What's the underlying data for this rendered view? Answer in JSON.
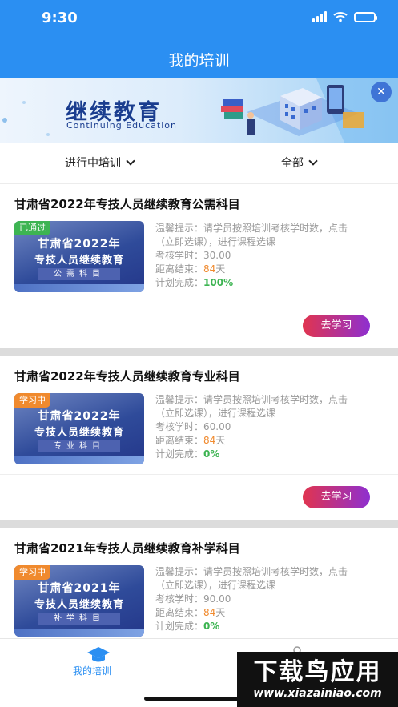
{
  "status_bar": {
    "time": "9:30"
  },
  "header": {
    "title": "我的培训"
  },
  "banner": {
    "title": "继续教育",
    "subtitle": "Continuing Education",
    "close": "✕"
  },
  "filters": [
    {
      "label": "进行中培训"
    },
    {
      "label": "全部"
    }
  ],
  "labels": {
    "tip_prefix": "温馨提示：",
    "hours_label": "考核学时：",
    "remaining_label": "距离结束：",
    "progress_label": "计划完成："
  },
  "courses": [
    {
      "title": "甘肃省2022年专技人员继续教育公需科目",
      "status": "已通过",
      "thumb_line1": "甘肃省2022年",
      "thumb_line2": "专技人员继续教育",
      "thumb_line3": "公需科目",
      "tip_line1": "请学员按照培训考核学时数，点击",
      "tip_line2": "（立即选课），进行课程选课",
      "hours": "30.00",
      "days": "84",
      "days_unit": "天",
      "progress": "100%",
      "button": "去学习"
    },
    {
      "title": "甘肃省2022年专技人员继续教育专业科目",
      "status": "学习中",
      "thumb_line1": "甘肃省2022年",
      "thumb_line2": "专技人员继续教育",
      "thumb_line3": "专业科目",
      "tip_line1": "请学员按照培训考核学时数，点击",
      "tip_line2": "（立即选课），进行课程选课",
      "hours": "60.00",
      "days": "84",
      "days_unit": "天",
      "progress": "0%",
      "button": "去学习"
    },
    {
      "title": "甘肃省2021年专技人员继续教育补学科目",
      "status": "学习中",
      "thumb_line1": "甘肃省2021年",
      "thumb_line2": "专技人员继续教育",
      "thumb_line3": "补学科目",
      "tip_line1": "请学员按照培训考核学时数，点击",
      "tip_line2": "（立即选课），进行课程选课",
      "hours": "90.00",
      "days": "84",
      "days_unit": "天",
      "progress": "0%"
    }
  ],
  "tabbar": {
    "tab1_label": "我的培训"
  },
  "watermark": {
    "title": "下载鸟应用",
    "url": "www.xiazainiao.com"
  }
}
